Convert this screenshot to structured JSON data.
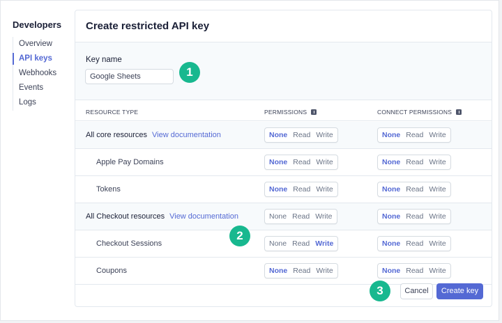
{
  "sidebar": {
    "title": "Developers",
    "items": [
      {
        "label": "Overview"
      },
      {
        "label": "API keys"
      },
      {
        "label": "Webhooks"
      },
      {
        "label": "Events"
      },
      {
        "label": "Logs"
      }
    ]
  },
  "panel": {
    "title": "Create restricted API key",
    "key_name_label": "Key name",
    "key_name_value": "Google Sheets"
  },
  "table": {
    "headers": {
      "resource_type": "RESOURCE TYPE",
      "permissions": "PERMISSIONS",
      "connect_permissions": "CONNECT PERMISSIONS"
    },
    "options": [
      "None",
      "Read",
      "Write"
    ],
    "rows": [
      {
        "name": "All core resources",
        "link": "View documentation",
        "permission": "None",
        "connect": "None"
      },
      {
        "name": "Apple Pay Domains",
        "permission": "None",
        "connect": "None"
      },
      {
        "name": "Tokens",
        "permission": "None",
        "connect": "None"
      },
      {
        "name": "All Checkout resources",
        "link": "View documentation",
        "permission": "",
        "connect": "None"
      },
      {
        "name": "Checkout Sessions",
        "permission": "Write",
        "connect": "None"
      },
      {
        "name": "Coupons",
        "permission": "None",
        "connect": "None"
      }
    ]
  },
  "footer": {
    "cancel_label": "Cancel",
    "create_label": "Create key"
  },
  "steps": [
    "1",
    "2",
    "3"
  ],
  "colors": {
    "accent": "#5469d4",
    "step_badge": "#18b88f"
  }
}
